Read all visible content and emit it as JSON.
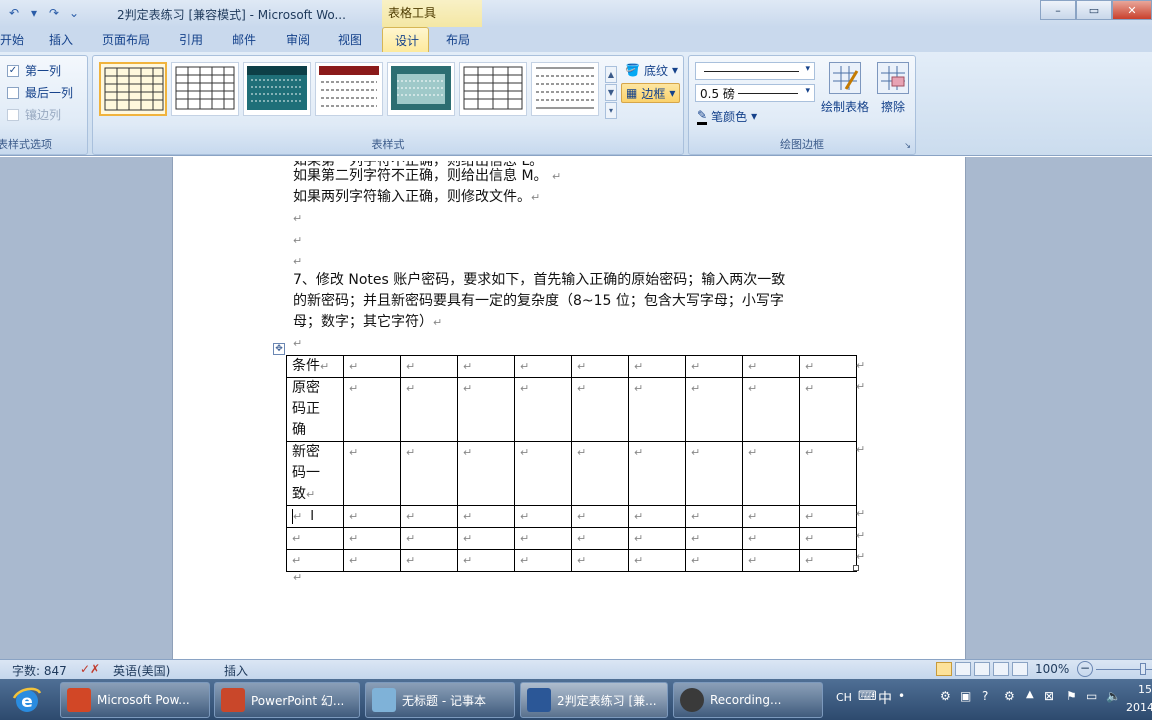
{
  "window": {
    "title": "2判定表练习 [兼容模式] - Microsoft Wo...",
    "contextual_title": "表格工具"
  },
  "tabs": [
    "开始",
    "插入",
    "页面布局",
    "引用",
    "邮件",
    "审阅",
    "视图",
    "设计",
    "布局"
  ],
  "ribbon": {
    "options_group": {
      "label": "表样式选项",
      "items": [
        {
          "label": "第一列",
          "checked": true,
          "enabled": true
        },
        {
          "label": "最后一列",
          "checked": false,
          "enabled": true
        },
        {
          "label": "镶边列",
          "checked": false,
          "enabled": false
        }
      ]
    },
    "styles_group": {
      "label": "表样式",
      "shading_label": "底纹",
      "borders_label": "边框"
    },
    "draw_group": {
      "label": "绘图边框",
      "weight": "0.5 磅",
      "pen_color": "笔颜色",
      "draw_table": "绘制表格",
      "eraser": "擦除"
    }
  },
  "document": {
    "lines": [
      "如果第二列字符不正确，则给出信息 M。",
      "如果两列字符输入正确，则修改文件。"
    ],
    "question": [
      "7、修改 Notes 账户密码，要求如下，首先输入正确的原始密码；输入两次一致",
      "的新密码；并且新密码要具有一定的复杂度（8~15 位；包含大写字母；小写字",
      "母；数字；其它字符）"
    ],
    "table_rows": [
      [
        "条件"
      ],
      [
        "原密",
        "码正",
        "确"
      ],
      [
        "新密",
        "码一",
        "致"
      ],
      [
        ""
      ],
      [
        ""
      ],
      [
        ""
      ]
    ]
  },
  "status": {
    "word_count": "字数: 847",
    "language": "英语(美国)",
    "mode": "插入",
    "zoom": "100%"
  },
  "taskbar": {
    "items": [
      "Microsoft Pow...",
      "PowerPoint 幻...",
      "无标题 - 记事本",
      "2判定表练习 [兼...",
      "Recording..."
    ],
    "tray_lang": "CH",
    "ime": "中",
    "clock": "15",
    "year": "2014"
  }
}
